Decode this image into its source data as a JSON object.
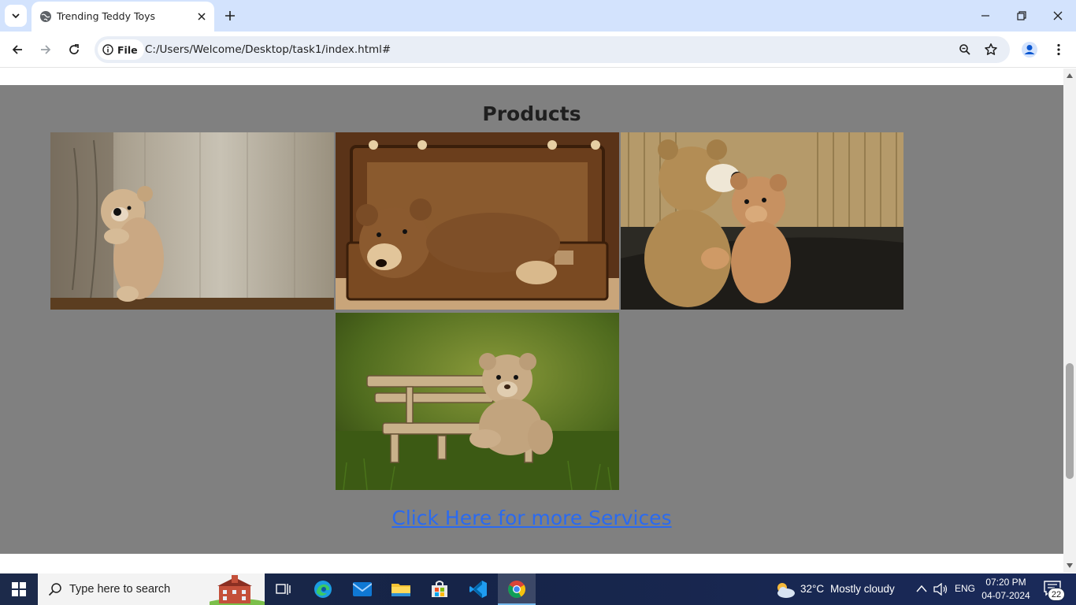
{
  "browser": {
    "tab_title": "Trending Teddy Toys",
    "url_chip": "File",
    "url": "C:/Users/Welcome/Desktop/task1/index.html#"
  },
  "page": {
    "section_title": "Products",
    "products": [
      {
        "icon": "teddy-peeking-wood-photo"
      },
      {
        "icon": "teddy-in-suitcase-photo"
      },
      {
        "icon": "two-teddies-hugging-photo"
      },
      {
        "icon": "teddy-on-bench-photo"
      }
    ],
    "more_link": "Click Here for more Services",
    "background_color": "#808080",
    "link_color": "#2a6af0"
  },
  "taskbar": {
    "search_placeholder": "Type here to search",
    "weather_temp": "32°C",
    "weather_desc": "Mostly cloudy",
    "language": "ENG",
    "time": "07:20 PM",
    "date": "04-07-2024",
    "notification_count": "22"
  }
}
